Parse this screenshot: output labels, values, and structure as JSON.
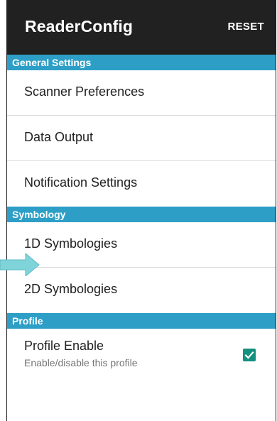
{
  "appbar": {
    "title": "ReaderConfig",
    "action_label": "RESET"
  },
  "sections": [
    {
      "header": "General Settings",
      "items": [
        {
          "label": "Scanner Preferences"
        },
        {
          "label": "Data Output"
        },
        {
          "label": "Notification Settings"
        }
      ]
    },
    {
      "header": "Symbology",
      "items": [
        {
          "label": "1D Symbologies"
        },
        {
          "label": "2D Symbologies"
        }
      ]
    },
    {
      "header": "Profile",
      "items": [
        {
          "label": "Profile Enable",
          "summary": "Enable/disable this profile",
          "checked": true
        }
      ]
    }
  ],
  "colors": {
    "appbar": "#212121",
    "section_header": "#2d9fc7",
    "checkbox": "#13907f",
    "pointer_arrow": "#7fd4da"
  },
  "icons": {
    "checkbox": "check-icon",
    "pointer": "pointer-arrow-icon"
  }
}
